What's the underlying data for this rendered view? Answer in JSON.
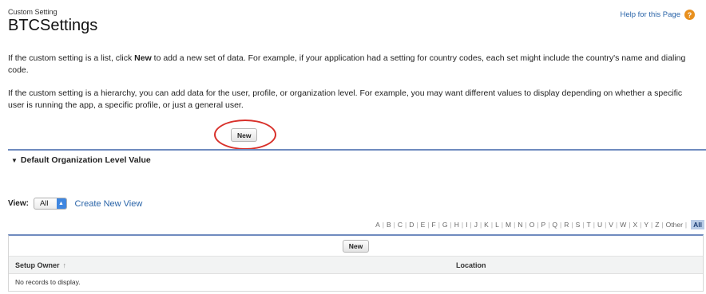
{
  "header": {
    "supertitle": "Custom Setting",
    "title": "BTCSettings",
    "help_link": "Help for this Page",
    "help_icon_glyph": "?"
  },
  "intro": {
    "p1_before": "If the custom setting is a list, click ",
    "p1_bold": "New",
    "p1_after": " to add a new set of data. For example, if your application had a setting for country codes, each set might include the country's name and dialing code.",
    "p2": "If the custom setting is a hierarchy, you can add data for the user, profile, or organization level. For example, you may want different values to display depending on whether a specific user is running the app, a specific profile, or just a general user."
  },
  "top_button": {
    "label": "New"
  },
  "section": {
    "toggle_glyph": "▼",
    "title": "Default Organization Level Value"
  },
  "view": {
    "label": "View:",
    "selected": "All",
    "create_link": "Create New View"
  },
  "alpha": {
    "letters": [
      "A",
      "B",
      "C",
      "D",
      "E",
      "F",
      "G",
      "H",
      "I",
      "J",
      "K",
      "L",
      "M",
      "N",
      "O",
      "P",
      "Q",
      "R",
      "S",
      "T",
      "U",
      "V",
      "W",
      "X",
      "Y",
      "Z",
      "Other"
    ],
    "all_label": "All"
  },
  "table": {
    "new_label": "New",
    "columns": [
      "Setup Owner",
      "Location"
    ],
    "sort_glyph": "↑",
    "empty_text": "No records to display."
  },
  "colors": {
    "link": "#2a64a8",
    "highlight_circle": "#d8302a",
    "divider": "#6f8bbf",
    "help_icon": "#e8901e"
  },
  "icons": {
    "help": "help-icon",
    "toggle": "triangle-down-icon",
    "select_arrow": "select-arrows-icon",
    "sort": "sort-ascending-icon"
  }
}
